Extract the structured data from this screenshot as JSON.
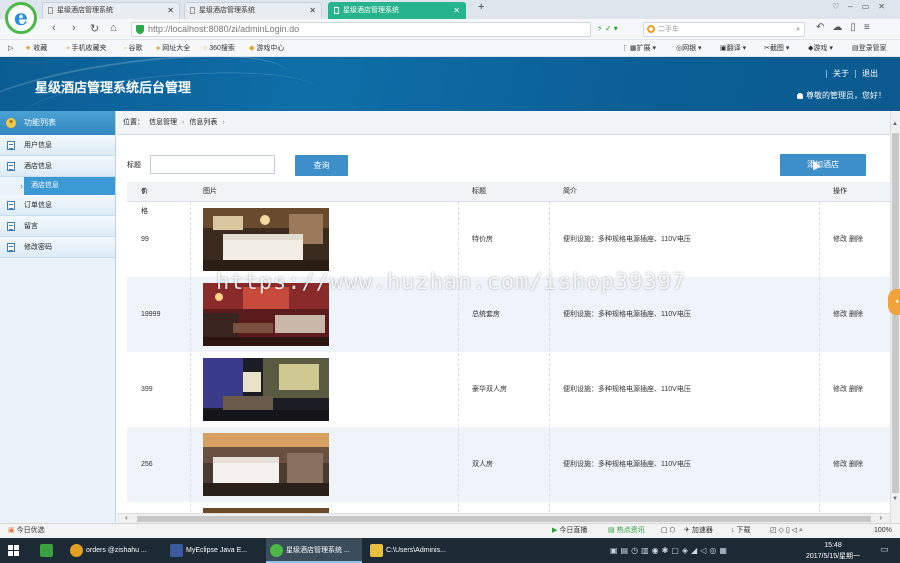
{
  "browser": {
    "tabs": [
      {
        "label": "星级酒店管理系统",
        "active": false
      },
      {
        "label": "星级酒店管理系统",
        "active": false
      },
      {
        "label": "星级酒店管理系统",
        "active": true
      }
    ],
    "new_tab": "+",
    "url_host": "http://localhost",
    "url_rest": ":8080/zi/adminLogin.do",
    "search_placeholder": "二手车",
    "bookmarks": [
      "收藏",
      "手机收藏夹",
      "谷歌",
      "网址大全",
      "360搜索",
      "游戏中心"
    ],
    "bookmarks_right": [
      "扩展",
      "网银",
      "翻译",
      "截图",
      "游戏",
      "登录管家"
    ]
  },
  "header": {
    "title": "星级酒店管理系统后台管理",
    "links": [
      "关于",
      "退出"
    ],
    "greeting": "尊敬的管理员，您好！"
  },
  "sidebar": {
    "heading": "功能列表",
    "items": [
      {
        "label": "用户信息"
      },
      {
        "label": "酒店信息",
        "sub": "酒店信息"
      },
      {
        "label": "订单信息"
      },
      {
        "label": "留言"
      },
      {
        "label": "修改密码"
      }
    ]
  },
  "breadcrumb": {
    "prefix": "位置：",
    "items": [
      "信息管理",
      "信息列表"
    ]
  },
  "search": {
    "label": "标题",
    "value": "",
    "button": "查询",
    "add_button": "添加酒店"
  },
  "table": {
    "headers": [
      "价格",
      "图片",
      "标题",
      "简介",
      "操作"
    ],
    "rows": [
      {
        "price": "99",
        "title": "特价房",
        "intro": "便利设施：多种规格电源插座、110V电压",
        "edit": "修改",
        "delete": "删除"
      },
      {
        "price": "19999",
        "title": "总统套房",
        "intro": "便利设施：多种规格电源插座、110V电压",
        "edit": "修改",
        "delete": "删除"
      },
      {
        "price": "399",
        "title": "豪华双人房",
        "intro": "便利设施：多种规格电源插座、110V电压",
        "edit": "修改",
        "delete": "删除"
      },
      {
        "price": "256",
        "title": "双人房",
        "intro": "便利设施：多种规格电源插座、110V电压",
        "edit": "修改",
        "delete": "删除"
      }
    ]
  },
  "watermark": "https://www.huzhan.com/ishop39397",
  "statusbar": {
    "left": "今日优选",
    "items": [
      "今日直播",
      "热点资讯",
      "加速器",
      "下载"
    ],
    "zoom": "100%"
  },
  "taskbar": {
    "items": [
      {
        "label": "orders @zishahu ...",
        "active": false
      },
      {
        "label": "MyEclipse Java E...",
        "active": false
      },
      {
        "label": "星级酒店管理系统 ...",
        "active": true
      },
      {
        "label": "C:\\Users\\Adminis...",
        "active": false
      }
    ],
    "time": "15:48",
    "date": "2017/5/15/星期一"
  }
}
